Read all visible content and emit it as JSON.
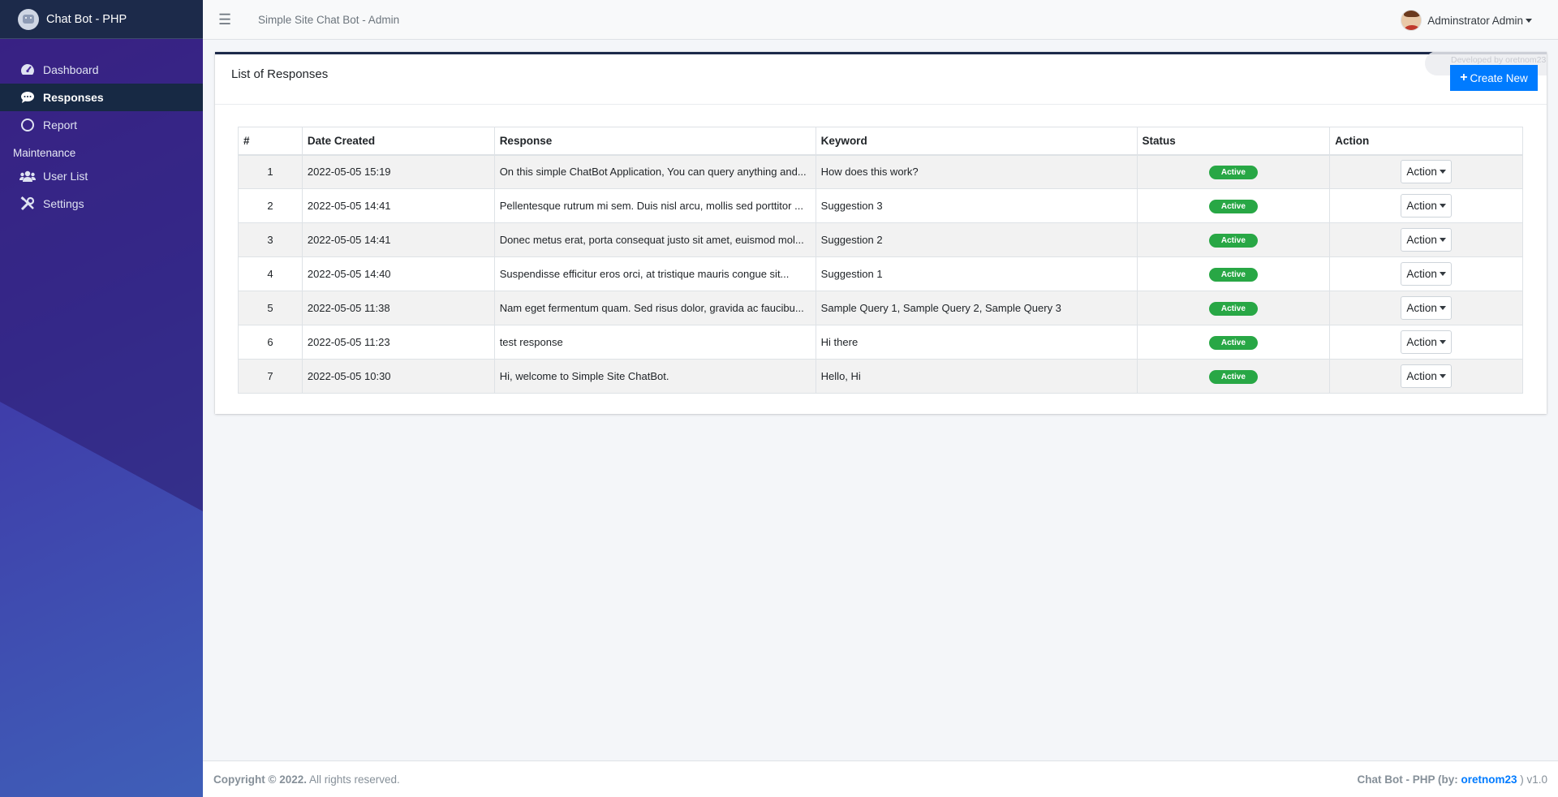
{
  "brand": {
    "name": "Chat Bot - PHP"
  },
  "sidebar": {
    "items": [
      {
        "label": "Dashboard",
        "icon": "dashboard-icon"
      },
      {
        "label": "Responses",
        "icon": "comment-icon",
        "active": true
      },
      {
        "label": "Report",
        "icon": "circle-icon"
      }
    ],
    "maintenance_header": "Maintenance",
    "maintenance_items": [
      {
        "label": "User List",
        "icon": "users-icon"
      },
      {
        "label": "Settings",
        "icon": "tools-icon"
      }
    ]
  },
  "topbar": {
    "site_title": "Simple Site Chat Bot - Admin",
    "user_name": "Adminstrator Admin"
  },
  "card": {
    "title": "List of Responses",
    "create_label": "Create New",
    "dev_note": "Developed by oretnom23"
  },
  "table": {
    "headers": [
      "#",
      "Date Created",
      "Response",
      "Keyword",
      "Status",
      "Action"
    ],
    "rows": [
      {
        "num": "1",
        "date": "2022-05-05 15:19",
        "response": "On this simple ChatBot Application, You can query anything and...",
        "keyword": "How does this work?",
        "status": "Active",
        "action": "Action"
      },
      {
        "num": "2",
        "date": "2022-05-05 14:41",
        "response": "Pellentesque rutrum mi sem. Duis nisl arcu, mollis sed porttitor ...",
        "keyword": "Suggestion 3",
        "status": "Active",
        "action": "Action"
      },
      {
        "num": "3",
        "date": "2022-05-05 14:41",
        "response": "Donec metus erat, porta consequat justo sit amet, euismod mol...",
        "keyword": "Suggestion 2",
        "status": "Active",
        "action": "Action"
      },
      {
        "num": "4",
        "date": "2022-05-05 14:40",
        "response": "Suspendisse efficitur eros orci, at tristique mauris congue sit...",
        "keyword": "Suggestion 1",
        "status": "Active",
        "action": "Action"
      },
      {
        "num": "5",
        "date": "2022-05-05 11:38",
        "response": "Nam eget fermentum quam. Sed risus dolor, gravida ac faucibu...",
        "keyword": "Sample Query 1, Sample Query 2, Sample Query 3",
        "status": "Active",
        "action": "Action"
      },
      {
        "num": "6",
        "date": "2022-05-05 11:23",
        "response": "test response",
        "keyword": "Hi there",
        "status": "Active",
        "action": "Action"
      },
      {
        "num": "7",
        "date": "2022-05-05 10:30",
        "response": "Hi, welcome to Simple Site ChatBot.",
        "keyword": "Hello, Hi",
        "status": "Active",
        "action": "Action"
      }
    ]
  },
  "footer": {
    "copyright_bold": "Copyright © 2022.",
    "copyright_rest": " All rights reserved.",
    "credit_prefix": "Chat Bot - PHP (by: ",
    "credit_link": "oretnom23",
    "credit_suffix": " ) v1.0"
  },
  "colors": {
    "accent": "#007bff",
    "status_active": "#28a745",
    "brand_bar": "#1c2a4a"
  }
}
